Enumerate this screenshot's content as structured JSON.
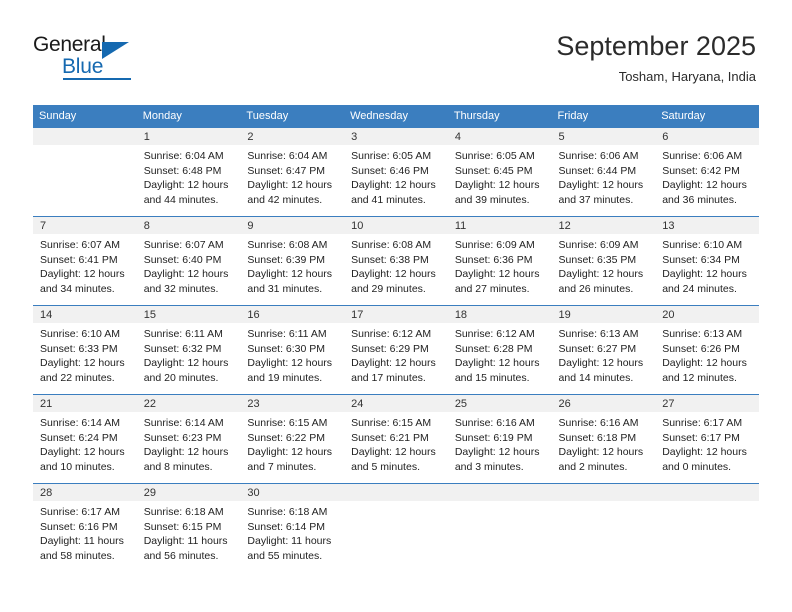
{
  "brand": {
    "name_top": "General",
    "name_bottom": "Blue",
    "accent_color": "#1569b0",
    "triangle_icon": "triangle-icon"
  },
  "header": {
    "title": "September 2025",
    "subtitle": "Tosham, Haryana, India"
  },
  "calendar": {
    "header_bg": "#3b7ebf",
    "daynum_bg": "#f1f1f1",
    "weekday_headers": [
      "Sunday",
      "Monday",
      "Tuesday",
      "Wednesday",
      "Thursday",
      "Friday",
      "Saturday"
    ],
    "weeks": [
      [
        {
          "day": "",
          "sunrise": "",
          "sunset": "",
          "daylight_line1": "",
          "daylight_line2": ""
        },
        {
          "day": "1",
          "sunrise": "Sunrise: 6:04 AM",
          "sunset": "Sunset: 6:48 PM",
          "daylight_line1": "Daylight: 12 hours",
          "daylight_line2": "and 44 minutes."
        },
        {
          "day": "2",
          "sunrise": "Sunrise: 6:04 AM",
          "sunset": "Sunset: 6:47 PM",
          "daylight_line1": "Daylight: 12 hours",
          "daylight_line2": "and 42 minutes."
        },
        {
          "day": "3",
          "sunrise": "Sunrise: 6:05 AM",
          "sunset": "Sunset: 6:46 PM",
          "daylight_line1": "Daylight: 12 hours",
          "daylight_line2": "and 41 minutes."
        },
        {
          "day": "4",
          "sunrise": "Sunrise: 6:05 AM",
          "sunset": "Sunset: 6:45 PM",
          "daylight_line1": "Daylight: 12 hours",
          "daylight_line2": "and 39 minutes."
        },
        {
          "day": "5",
          "sunrise": "Sunrise: 6:06 AM",
          "sunset": "Sunset: 6:44 PM",
          "daylight_line1": "Daylight: 12 hours",
          "daylight_line2": "and 37 minutes."
        },
        {
          "day": "6",
          "sunrise": "Sunrise: 6:06 AM",
          "sunset": "Sunset: 6:42 PM",
          "daylight_line1": "Daylight: 12 hours",
          "daylight_line2": "and 36 minutes."
        }
      ],
      [
        {
          "day": "7",
          "sunrise": "Sunrise: 6:07 AM",
          "sunset": "Sunset: 6:41 PM",
          "daylight_line1": "Daylight: 12 hours",
          "daylight_line2": "and 34 minutes."
        },
        {
          "day": "8",
          "sunrise": "Sunrise: 6:07 AM",
          "sunset": "Sunset: 6:40 PM",
          "daylight_line1": "Daylight: 12 hours",
          "daylight_line2": "and 32 minutes."
        },
        {
          "day": "9",
          "sunrise": "Sunrise: 6:08 AM",
          "sunset": "Sunset: 6:39 PM",
          "daylight_line1": "Daylight: 12 hours",
          "daylight_line2": "and 31 minutes."
        },
        {
          "day": "10",
          "sunrise": "Sunrise: 6:08 AM",
          "sunset": "Sunset: 6:38 PM",
          "daylight_line1": "Daylight: 12 hours",
          "daylight_line2": "and 29 minutes."
        },
        {
          "day": "11",
          "sunrise": "Sunrise: 6:09 AM",
          "sunset": "Sunset: 6:36 PM",
          "daylight_line1": "Daylight: 12 hours",
          "daylight_line2": "and 27 minutes."
        },
        {
          "day": "12",
          "sunrise": "Sunrise: 6:09 AM",
          "sunset": "Sunset: 6:35 PM",
          "daylight_line1": "Daylight: 12 hours",
          "daylight_line2": "and 26 minutes."
        },
        {
          "day": "13",
          "sunrise": "Sunrise: 6:10 AM",
          "sunset": "Sunset: 6:34 PM",
          "daylight_line1": "Daylight: 12 hours",
          "daylight_line2": "and 24 minutes."
        }
      ],
      [
        {
          "day": "14",
          "sunrise": "Sunrise: 6:10 AM",
          "sunset": "Sunset: 6:33 PM",
          "daylight_line1": "Daylight: 12 hours",
          "daylight_line2": "and 22 minutes."
        },
        {
          "day": "15",
          "sunrise": "Sunrise: 6:11 AM",
          "sunset": "Sunset: 6:32 PM",
          "daylight_line1": "Daylight: 12 hours",
          "daylight_line2": "and 20 minutes."
        },
        {
          "day": "16",
          "sunrise": "Sunrise: 6:11 AM",
          "sunset": "Sunset: 6:30 PM",
          "daylight_line1": "Daylight: 12 hours",
          "daylight_line2": "and 19 minutes."
        },
        {
          "day": "17",
          "sunrise": "Sunrise: 6:12 AM",
          "sunset": "Sunset: 6:29 PM",
          "daylight_line1": "Daylight: 12 hours",
          "daylight_line2": "and 17 minutes."
        },
        {
          "day": "18",
          "sunrise": "Sunrise: 6:12 AM",
          "sunset": "Sunset: 6:28 PM",
          "daylight_line1": "Daylight: 12 hours",
          "daylight_line2": "and 15 minutes."
        },
        {
          "day": "19",
          "sunrise": "Sunrise: 6:13 AM",
          "sunset": "Sunset: 6:27 PM",
          "daylight_line1": "Daylight: 12 hours",
          "daylight_line2": "and 14 minutes."
        },
        {
          "day": "20",
          "sunrise": "Sunrise: 6:13 AM",
          "sunset": "Sunset: 6:26 PM",
          "daylight_line1": "Daylight: 12 hours",
          "daylight_line2": "and 12 minutes."
        }
      ],
      [
        {
          "day": "21",
          "sunrise": "Sunrise: 6:14 AM",
          "sunset": "Sunset: 6:24 PM",
          "daylight_line1": "Daylight: 12 hours",
          "daylight_line2": "and 10 minutes."
        },
        {
          "day": "22",
          "sunrise": "Sunrise: 6:14 AM",
          "sunset": "Sunset: 6:23 PM",
          "daylight_line1": "Daylight: 12 hours",
          "daylight_line2": "and 8 minutes."
        },
        {
          "day": "23",
          "sunrise": "Sunrise: 6:15 AM",
          "sunset": "Sunset: 6:22 PM",
          "daylight_line1": "Daylight: 12 hours",
          "daylight_line2": "and 7 minutes."
        },
        {
          "day": "24",
          "sunrise": "Sunrise: 6:15 AM",
          "sunset": "Sunset: 6:21 PM",
          "daylight_line1": "Daylight: 12 hours",
          "daylight_line2": "and 5 minutes."
        },
        {
          "day": "25",
          "sunrise": "Sunrise: 6:16 AM",
          "sunset": "Sunset: 6:19 PM",
          "daylight_line1": "Daylight: 12 hours",
          "daylight_line2": "and 3 minutes."
        },
        {
          "day": "26",
          "sunrise": "Sunrise: 6:16 AM",
          "sunset": "Sunset: 6:18 PM",
          "daylight_line1": "Daylight: 12 hours",
          "daylight_line2": "and 2 minutes."
        },
        {
          "day": "27",
          "sunrise": "Sunrise: 6:17 AM",
          "sunset": "Sunset: 6:17 PM",
          "daylight_line1": "Daylight: 12 hours",
          "daylight_line2": "and 0 minutes."
        }
      ],
      [
        {
          "day": "28",
          "sunrise": "Sunrise: 6:17 AM",
          "sunset": "Sunset: 6:16 PM",
          "daylight_line1": "Daylight: 11 hours",
          "daylight_line2": "and 58 minutes."
        },
        {
          "day": "29",
          "sunrise": "Sunrise: 6:18 AM",
          "sunset": "Sunset: 6:15 PM",
          "daylight_line1": "Daylight: 11 hours",
          "daylight_line2": "and 56 minutes."
        },
        {
          "day": "30",
          "sunrise": "Sunrise: 6:18 AM",
          "sunset": "Sunset: 6:14 PM",
          "daylight_line1": "Daylight: 11 hours",
          "daylight_line2": "and 55 minutes."
        },
        {
          "day": "",
          "sunrise": "",
          "sunset": "",
          "daylight_line1": "",
          "daylight_line2": ""
        },
        {
          "day": "",
          "sunrise": "",
          "sunset": "",
          "daylight_line1": "",
          "daylight_line2": ""
        },
        {
          "day": "",
          "sunrise": "",
          "sunset": "",
          "daylight_line1": "",
          "daylight_line2": ""
        },
        {
          "day": "",
          "sunrise": "",
          "sunset": "",
          "daylight_line1": "",
          "daylight_line2": ""
        }
      ]
    ]
  }
}
